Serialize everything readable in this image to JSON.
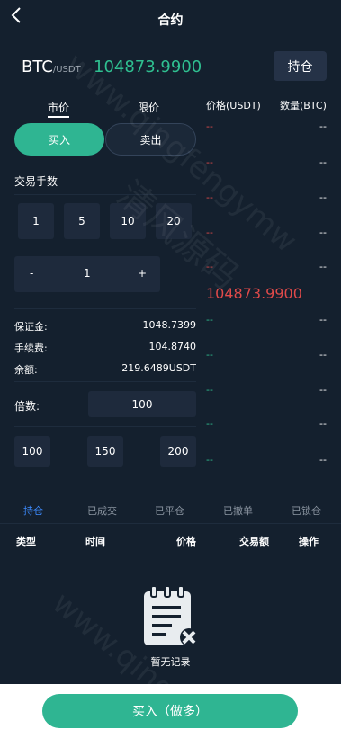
{
  "header": {
    "title": "合约"
  },
  "ticker": {
    "symbol": "BTC",
    "pair": "/USDT",
    "price": "104873.9900",
    "hold_label": "持仓"
  },
  "order_types": [
    "市价",
    "限价"
  ],
  "sides": {
    "buy": "买入",
    "sell": "卖出"
  },
  "quantity": {
    "label": "交易手数",
    "presets": [
      "1",
      "5",
      "10",
      "20"
    ],
    "minus": "-",
    "value": "1",
    "plus": "+"
  },
  "info": [
    {
      "label": "保证金:",
      "value": "1048.7399"
    },
    {
      "label": "手续费:",
      "value": "104.8740"
    },
    {
      "label": "余额:",
      "value": "219.6489USDT"
    }
  ],
  "leverage": {
    "label": "倍数:",
    "value": "100",
    "presets": [
      "100",
      "150",
      "200"
    ]
  },
  "orderbook": {
    "price_header": "价格(USDT)",
    "qty_header": "数量(BTC)",
    "asks": [
      {
        "p": "--",
        "q": "--"
      },
      {
        "p": "--",
        "q": "--"
      },
      {
        "p": "--",
        "q": "--"
      },
      {
        "p": "--",
        "q": "--"
      },
      {
        "p": "--",
        "q": "--"
      }
    ],
    "mid_price": "104873.9900",
    "bids": [
      {
        "p": "--",
        "q": "--"
      },
      {
        "p": "--",
        "q": "--"
      },
      {
        "p": "--",
        "q": "--"
      },
      {
        "p": "--",
        "q": "--"
      },
      {
        "p": "--",
        "q": "--"
      }
    ]
  },
  "history_tabs": [
    "持仓",
    "已成交",
    "已平仓",
    "已撤单",
    "已锁仓"
  ],
  "table_headers": [
    "类型",
    "时间",
    "价格",
    "交易额",
    "操作"
  ],
  "empty_text": "暂无记录",
  "cta": "买入（做多）",
  "watermark": [
    "www.qingfengymw",
    "清风源码",
    "www.qingfe"
  ],
  "colors": {
    "accent": "#2fb592",
    "up": "#2fbf90",
    "down": "#e04a4a",
    "tab_active": "#3d8bff"
  }
}
